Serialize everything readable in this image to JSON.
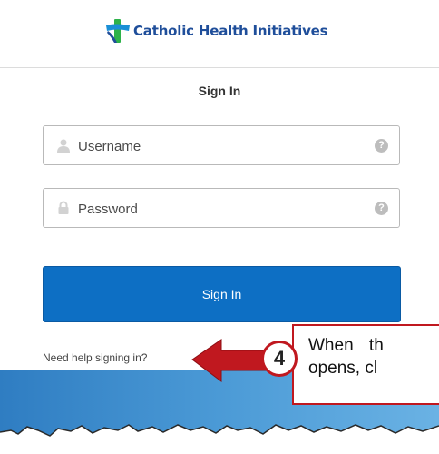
{
  "header": {
    "logo_text": "Catholic Health Initiatives"
  },
  "form": {
    "title": "Sign In",
    "username_placeholder": "Username",
    "password_placeholder": "Password",
    "help_glyph": "?",
    "submit_label": "Sign In",
    "help_link": "Need help signing in?"
  },
  "callout": {
    "step": "4",
    "line1": "When th",
    "line2": "opens, cl"
  },
  "colors": {
    "brand": "#1f4e9a",
    "button": "#0d6fc4",
    "callout": "#c0181f"
  }
}
